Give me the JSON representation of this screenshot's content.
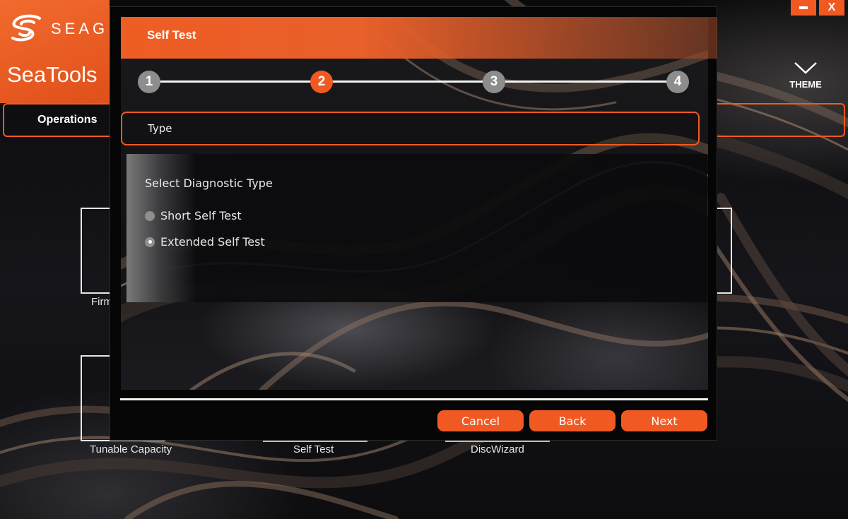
{
  "window": {
    "brand_text": "SEAG",
    "app_title": "SeaTools",
    "minimize_label": "",
    "close_label": "X"
  },
  "theme": {
    "label": "THEME"
  },
  "nav": {
    "operations_label": "Operations"
  },
  "background_tiles": [
    {
      "label": "Firm"
    },
    {
      "label": "Tunable Capacity"
    },
    {
      "label": "Self Test"
    },
    {
      "label": "DiscWizard"
    }
  ],
  "dialog": {
    "title": "Self Test",
    "steps": [
      "1",
      "2",
      "3",
      "4"
    ],
    "active_step": 2,
    "section_label": "Type",
    "diagnostic": {
      "title": "Select Diagnostic Type",
      "options": [
        {
          "label": "Short Self Test",
          "selected": false
        },
        {
          "label": "Extended Self Test",
          "selected": true
        }
      ]
    },
    "buttons": {
      "cancel": "Cancel",
      "back": "Back",
      "next": "Next"
    }
  },
  "colors": {
    "accent": "#f05a22",
    "background": "#0b0b0d"
  }
}
